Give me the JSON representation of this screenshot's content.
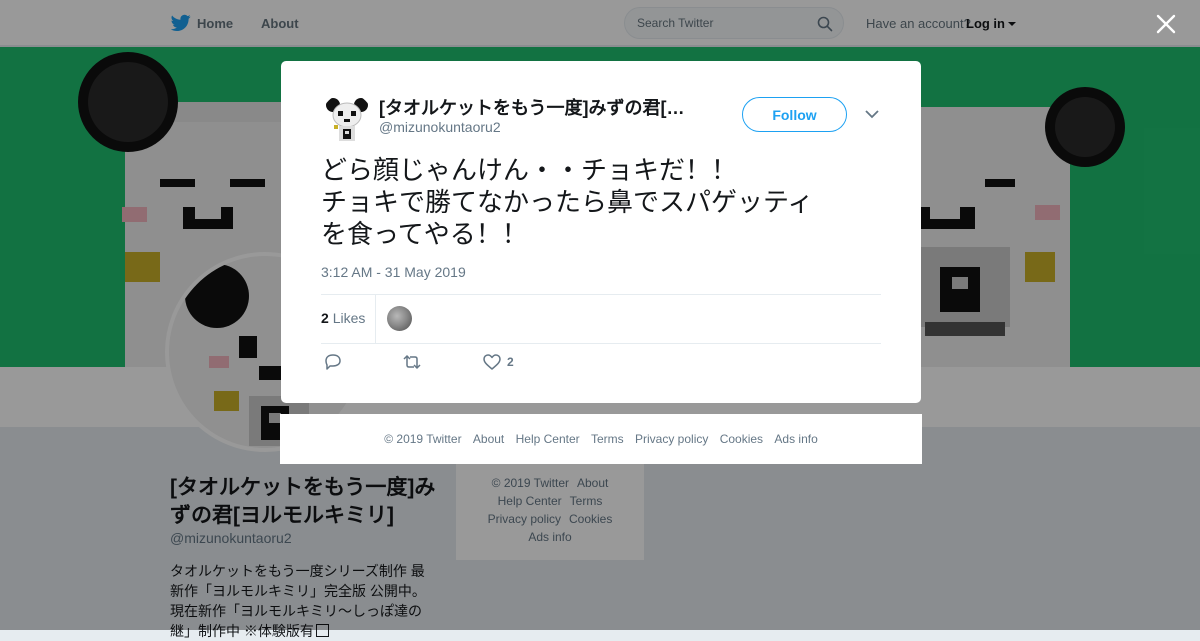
{
  "nav": {
    "home_label": "Home",
    "about_label": "About",
    "search_placeholder": "Search Twitter",
    "account_prompt": "Have an account?",
    "login_label": "Log in"
  },
  "profile": {
    "name": "[タオルケットをもう一度]みずの君[ヨルモルキミリ]",
    "handle": "@mizunokuntaoru2",
    "bio_lines": [
      "タオルケットをもう一度シリーズ制作 最",
      "新作「ヨルモルキミリ」完全版 公開中。",
      "現在新作「ヨルモルキミリ～しっぽ達の",
      "継」制作中 ※体験版有"
    ],
    "banner_color": "#1fbf6f"
  },
  "side_footer": {
    "copyright": "© 2019 Twitter",
    "about": "About",
    "help": "Help Center",
    "terms": "Terms",
    "privacy": "Privacy policy",
    "cookies": "Cookies",
    "ads": "Ads info"
  },
  "tweet": {
    "author_name": "[タオルケットをもう一度]みずの君[…",
    "author_handle": "@mizunokuntaoru2",
    "follow_label": "Follow",
    "text_lines": [
      "どら顔じゃんけん・・チョキだ！！",
      "チョキで勝てなかったら鼻でスパゲッティ",
      "を食ってやる！！"
    ],
    "timestamp": "3:12 AM - 31 May 2019",
    "likes_count": "2",
    "likes_label": "Likes",
    "like_action_count": "2",
    "accent_color": "#1da1f2"
  },
  "modal_footer": {
    "copyright": "© 2019 Twitter",
    "about": "About",
    "help": "Help Center",
    "terms": "Terms",
    "privacy": "Privacy policy",
    "cookies": "Cookies",
    "ads": "Ads info"
  },
  "icons": [
    "twitter-bird-icon",
    "search-icon",
    "caret-down-icon",
    "close-icon",
    "chevron-down-icon",
    "reply-icon",
    "retweet-icon",
    "heart-icon",
    "external-link-icon"
  ]
}
